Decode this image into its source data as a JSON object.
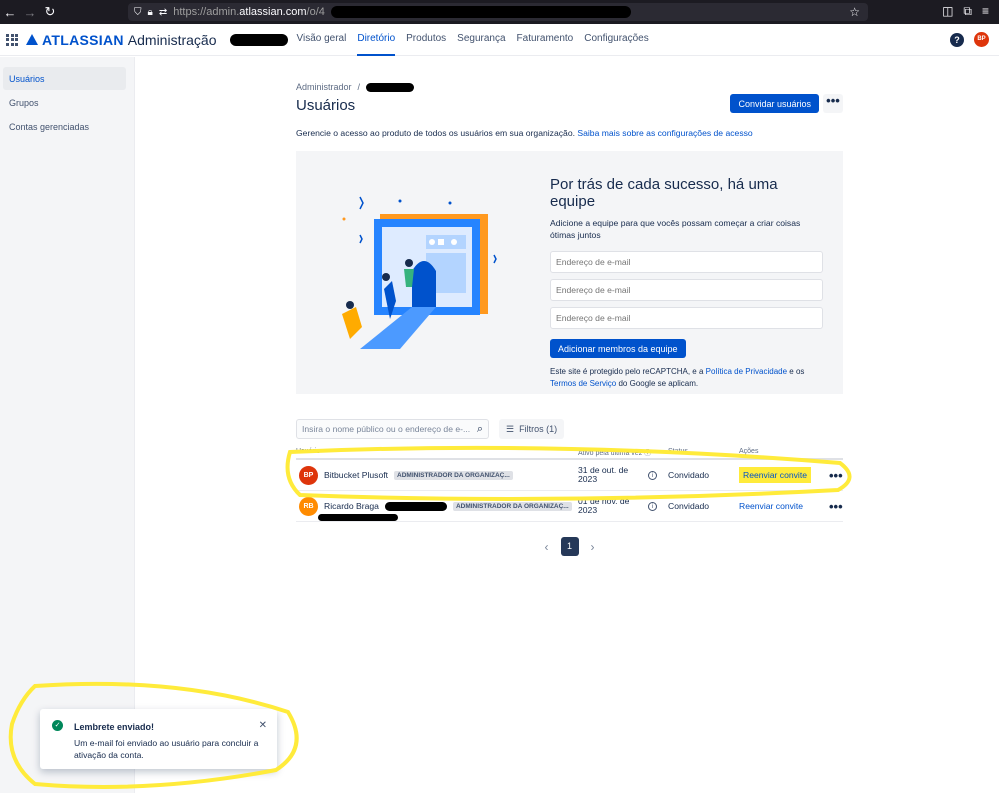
{
  "browser": {
    "url_prefix": "https://admin.",
    "url_domain": "atlassian.com",
    "url_path": "/o/4"
  },
  "header": {
    "logo_text": "ATLASSIAN",
    "product": "Administração",
    "nav": [
      "Visão geral",
      "Diretório",
      "Produtos",
      "Segurança",
      "Faturamento",
      "Configurações"
    ],
    "active_nav": "Diretório",
    "help": "?",
    "user_initials": "BP"
  },
  "sidebar": {
    "items": [
      {
        "label": "Usuários",
        "active": true
      },
      {
        "label": "Grupos",
        "active": false
      },
      {
        "label": "Contas gerenciadas",
        "active": false
      }
    ]
  },
  "page": {
    "breadcrumb_root": "Administrador",
    "breadcrumb_sep": "/",
    "title": "Usuários",
    "invite_button": "Convidar usuários",
    "more": "•••",
    "description": "Gerencie o acesso ao produto de todos os usuários em sua organização.",
    "description_link": "Saiba mais sobre as configurações de acesso"
  },
  "promo": {
    "title": "Por trás de cada sucesso, há uma equipe",
    "subtitle": "Adicione a equipe para que vocês possam começar a criar coisas ótimas juntos",
    "email_placeholder": "Endereço de e-mail",
    "add_button": "Adicionar membros da equipe",
    "captcha_text_1": "Este site é protegido pelo reCAPTCHA, e a",
    "privacy_link": "Política de Privacidade",
    "captcha_text_2": "e os",
    "terms_link": "Termos de Serviço",
    "captcha_text_3": "do Google se aplicam."
  },
  "filters": {
    "search_placeholder": "Insira o nome público ou o endereço de e-...",
    "filter_button": "Filtros (1)"
  },
  "table": {
    "columns": [
      "Usuário",
      "Ativo pela última vez",
      "Status",
      "Ações"
    ],
    "rows": [
      {
        "initials": "BP",
        "avatar_color": "#de350b",
        "name": "Bitbucket Plusoft",
        "role": "ADMINISTRADOR DA ORGANIZAÇ...",
        "last_active": "31 de out. de 2023",
        "status": "Convidado",
        "action": "Reenviar convite"
      },
      {
        "initials": "RB",
        "avatar_color": "#ff8b00",
        "name": "Ricardo Braga",
        "role": "ADMINISTRADOR DA ORGANIZAÇ...",
        "last_active": "01 de nov. de 2023",
        "status": "Convidado",
        "action": "Reenviar convite"
      }
    ]
  },
  "pagination": {
    "current": "1"
  },
  "toast": {
    "title": "Lembrete enviado!",
    "body": "Um e-mail foi enviado ao usuário para concluir a ativação da conta."
  },
  "colors": {
    "accent": "#0052cc",
    "highlight": "#ffeb3b",
    "success": "#00875a"
  }
}
